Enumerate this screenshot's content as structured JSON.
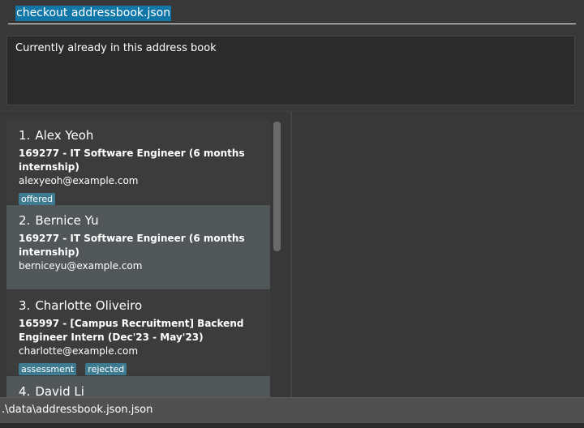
{
  "command": {
    "value": "checkout addressbook.json"
  },
  "result": {
    "message": "Currently already in this address book"
  },
  "persons": [
    {
      "index": "1.",
      "name": "Alex Yeoh",
      "job_line1": "169277 - IT Software Engineer (6 months",
      "job_line2": "internship)",
      "email": "alexyeoh@example.com",
      "tags": [
        "offered"
      ]
    },
    {
      "index": "2.",
      "name": "Bernice Yu",
      "job_line1": "169277 - IT Software Engineer (6 months",
      "job_line2": "internship)",
      "email": "berniceyu@example.com",
      "tags": []
    },
    {
      "index": "3.",
      "name": "Charlotte Oliveiro",
      "job_line1": "165997 - [Campus Recruitment] Backend",
      "job_line2": "Engineer Intern (Dec'23 - May'23)",
      "email": "charlotte@example.com",
      "tags": [
        "assessment",
        "rejected"
      ]
    },
    {
      "index": "4.",
      "name": "David Li"
    }
  ],
  "status": {
    "path": ".\\data\\addressbook.json.json"
  }
}
